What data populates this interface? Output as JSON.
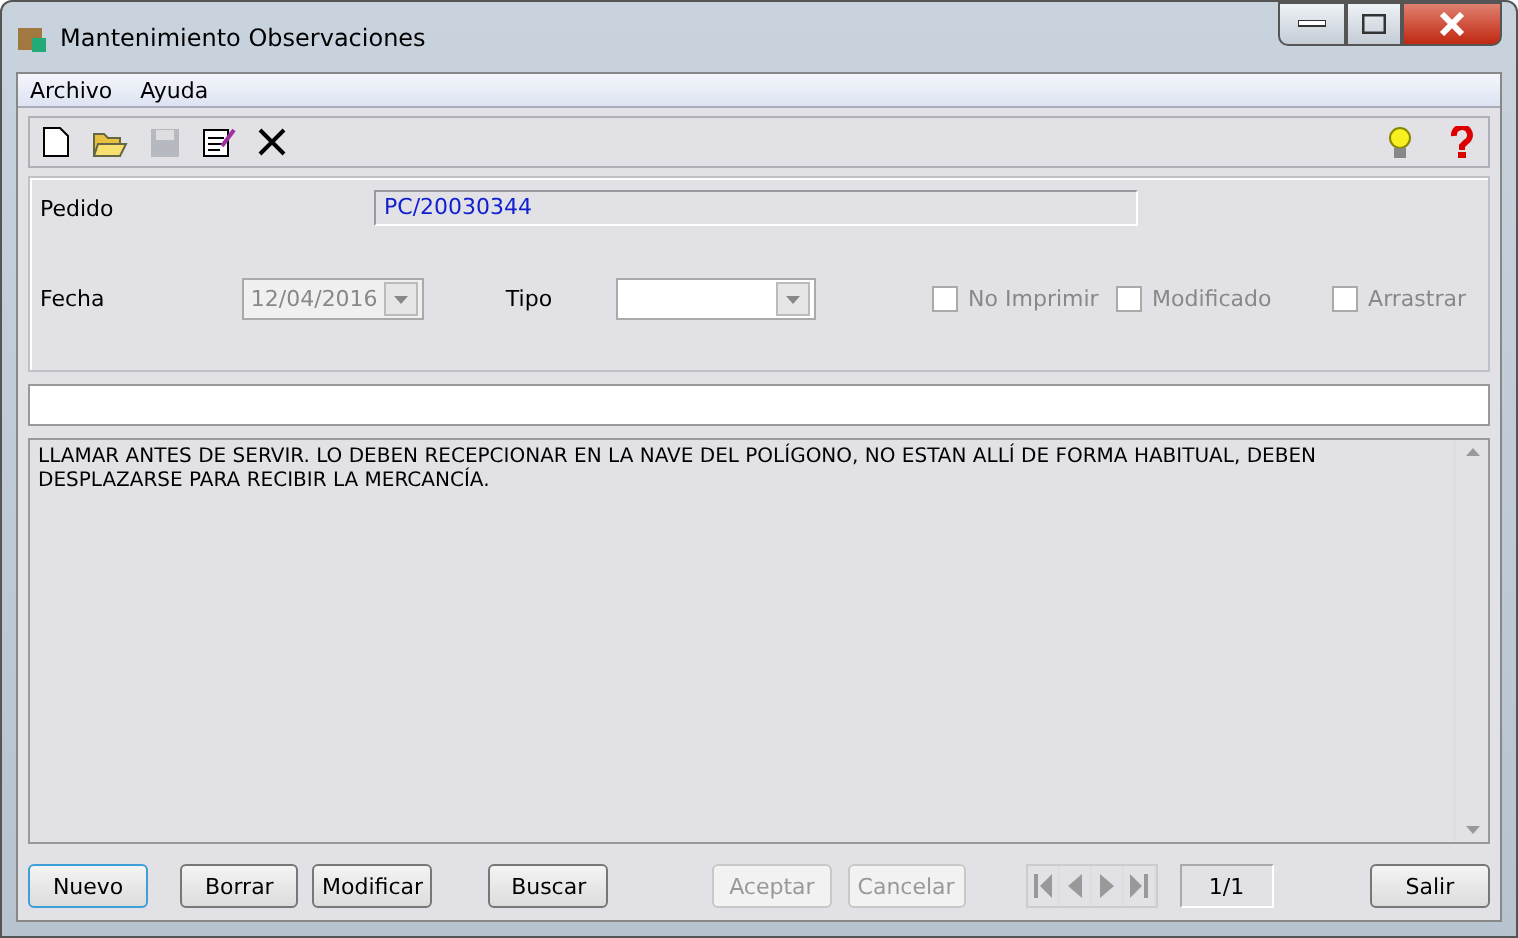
{
  "window": {
    "title": "Mantenimiento Observaciones"
  },
  "menu": [
    {
      "label": "Archivo"
    },
    {
      "label": "Ayuda"
    }
  ],
  "toolbar": [
    {
      "kind": "new",
      "disabled": false
    },
    {
      "kind": "open",
      "disabled": false
    },
    {
      "kind": "save",
      "disabled": true
    },
    {
      "kind": "edit",
      "disabled": false
    },
    {
      "kind": "delete",
      "disabled": false
    }
  ],
  "toolbar_right": [
    {
      "kind": "tip"
    },
    {
      "kind": "help"
    }
  ],
  "pedido": {
    "label": "Pedido",
    "value": "PC/20030344"
  },
  "fecha": {
    "label": "Fecha",
    "value": "12/04/2016",
    "disabled": true
  },
  "tipo": {
    "label": "Tipo"
  },
  "checkboxes": [
    {
      "label": "No Imprimir",
      "checked": false,
      "disabled": true
    },
    {
      "label": "Modificado",
      "checked": false,
      "disabled": true
    },
    {
      "label": "Arrastrar",
      "checked": false,
      "disabled": true
    }
  ],
  "observacion": "LLAMAR ANTES DE SERVIR. LO DEBEN RECEPCIONAR EN LA NAVE DEL POLÍGONO, NO ESTAN ALLÍ DE FORMA HABITUAL, DEBEN DESPLAZARSE PARA RECIBIR LA MERCANCÍA.",
  "buttons_left": [
    {
      "label": "Nuevo",
      "disabled": false,
      "focused": true
    },
    {
      "label": "Borrar",
      "disabled": false,
      "focused": false
    },
    {
      "label": "Modificar",
      "disabled": false,
      "focused": false
    },
    {
      "label": "Buscar",
      "disabled": false,
      "focused": false
    }
  ],
  "buttons_mid": [
    {
      "label": "Aceptar",
      "disabled": true
    },
    {
      "label": "Cancelar",
      "disabled": true
    }
  ],
  "navigator": {
    "disabled": true,
    "position": "1/1"
  },
  "exit_button": {
    "label": "Salir",
    "disabled": false
  }
}
